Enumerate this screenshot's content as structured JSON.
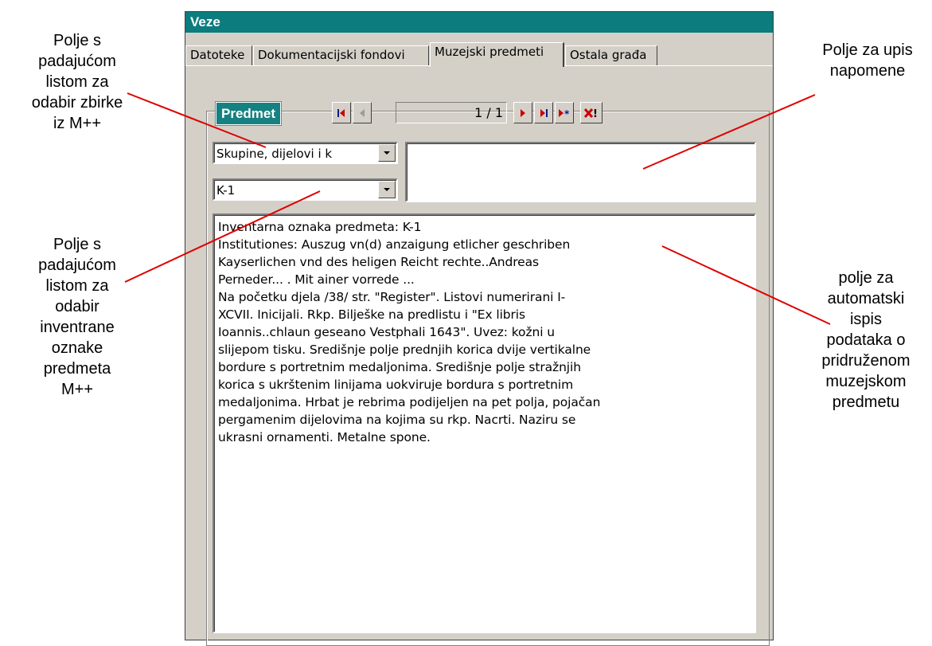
{
  "window": {
    "title": "Veze",
    "tabs": [
      {
        "label": "Datoteke",
        "active": false
      },
      {
        "label": "Dokumentacijski fondovi",
        "active": false
      },
      {
        "label": "Muzejski predmeti",
        "active": true
      },
      {
        "label": "Ostala građa",
        "active": false
      }
    ]
  },
  "record": {
    "group_label": "Predmet",
    "position": "1 / 1"
  },
  "fields": {
    "collection_value": "Skupine, dijelovi i k",
    "inventory_value": "K-1",
    "note_value": "",
    "details_lines": [
      "Inventarna oznaka predmeta: K-1",
      "Institutiones: Auszug vn(d) anzaigung etlicher geschriben",
      "Kayserlichen vnd des heligen Reicht rechte..Andreas",
      "Perneder... . Mit ainer vorrede ...",
      "Na početku djela /38/ str. \"Register\". Listovi numerirani I-",
      "XCVII. Inicijali. Rkp. Bilješke na predlistu i \"Ex libris",
      "Ioannis..chlaun geseano Vestphali 1643\". Uvez: kožni u",
      "slijepom tisku. Središnje polje prednjih korica dvije vertikalne",
      "bordure s portretnim medaljonima. Središnje polje stražnjih",
      "korica s ukrštenim linijama uokviruje bordura s portretnim",
      "medaljonima. Hrbat je rebrima podijeljen na pet polja, pojačan",
      "pergamenim dijelovima na kojima su rkp. Nacrti. Naziru se",
      "ukrasni ornamenti. Metalne spone."
    ]
  },
  "callouts": {
    "collection_dropdown": [
      "Polje s",
      "padajućom",
      "listom za",
      "odabir zbirke",
      "iz M++"
    ],
    "inventory_dropdown": [
      "Polje s",
      "padajućom",
      "listom za",
      "odabir",
      "inventrane",
      "oznake",
      "predmeta",
      "M++"
    ],
    "note_field": [
      "Polje za upis",
      "napomene"
    ],
    "auto_details": [
      "polje za",
      "automatski",
      "ispis",
      "podataka o",
      "pridruženom",
      "muzejskom",
      "predmetu"
    ]
  },
  "colors": {
    "titlebar": "#0c7c7e",
    "group_label_bg": "#168181",
    "callout_line": "#e00000",
    "nav_red": "#cc0000",
    "nav_blue": "#0a1a8c"
  },
  "icons": {
    "first": "first-record-icon",
    "prev": "prev-record-icon",
    "next": "next-record-icon",
    "last": "last-record-icon",
    "new": "new-record-icon",
    "delete": "delete-record-icon"
  }
}
